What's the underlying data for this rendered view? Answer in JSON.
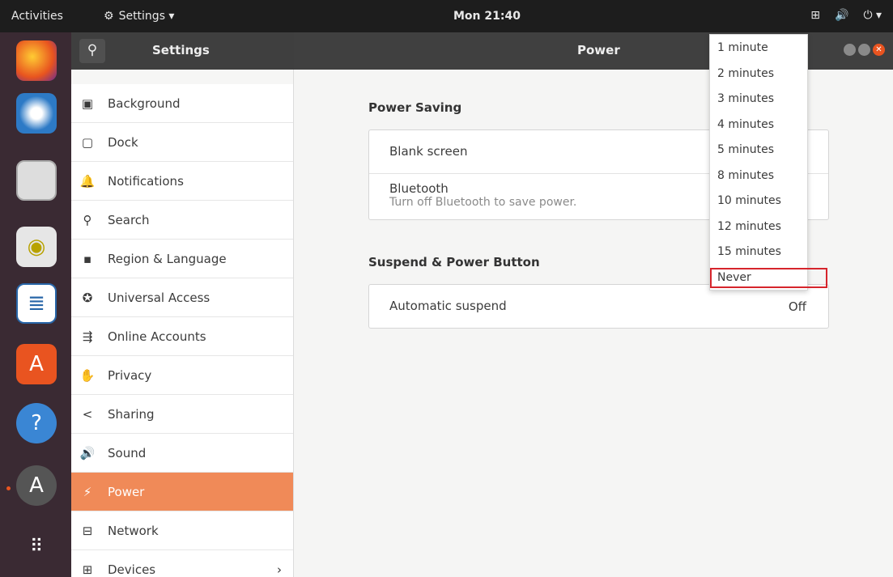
{
  "topbar": {
    "activities": "Activities",
    "app_menu": "Settings ▾",
    "clock": "Mon 21:40"
  },
  "header": {
    "left_title": "Settings",
    "right_title": "Power"
  },
  "sidebar": {
    "items": [
      {
        "label": "Background",
        "icon": "background-icon",
        "glyph": "▣"
      },
      {
        "label": "Dock",
        "icon": "dock-icon",
        "glyph": "▢"
      },
      {
        "label": "Notifications",
        "icon": "bell-icon",
        "glyph": "🔔"
      },
      {
        "label": "Search",
        "icon": "search-icon",
        "glyph": "⚲"
      },
      {
        "label": "Region & Language",
        "icon": "camera-icon",
        "glyph": "▪"
      },
      {
        "label": "Universal Access",
        "icon": "universal-access-icon",
        "glyph": "✪"
      },
      {
        "label": "Online Accounts",
        "icon": "online-accounts-icon",
        "glyph": "⇶"
      },
      {
        "label": "Privacy",
        "icon": "hand-icon",
        "glyph": "✋"
      },
      {
        "label": "Sharing",
        "icon": "share-icon",
        "glyph": "<"
      },
      {
        "label": "Sound",
        "icon": "speaker-icon",
        "glyph": "🔊"
      },
      {
        "label": "Power",
        "icon": "power-icon",
        "glyph": "⚡"
      },
      {
        "label": "Network",
        "icon": "network-icon",
        "glyph": "⊟"
      },
      {
        "label": "Devices",
        "icon": "devices-icon",
        "glyph": "⊞",
        "chevron": "›"
      }
    ],
    "active": "Power"
  },
  "power": {
    "saving_title": "Power Saving",
    "blank_screen": "Blank screen",
    "bluetooth": "Bluetooth",
    "bluetooth_sub": "Turn off Bluetooth to save power.",
    "suspend_title": "Suspend & Power Button",
    "auto_suspend": "Automatic suspend",
    "auto_suspend_value": "Off"
  },
  "dropdown": {
    "options": [
      "1 minute",
      "2 minutes",
      "3 minutes",
      "4 minutes",
      "5 minutes",
      "8 minutes",
      "10 minutes",
      "12 minutes",
      "15 minutes",
      "Never"
    ],
    "highlighted": "Never"
  },
  "colors": {
    "accent": "#e95420",
    "active_row": "#f08a58",
    "highlight_border": "#d6252c"
  }
}
